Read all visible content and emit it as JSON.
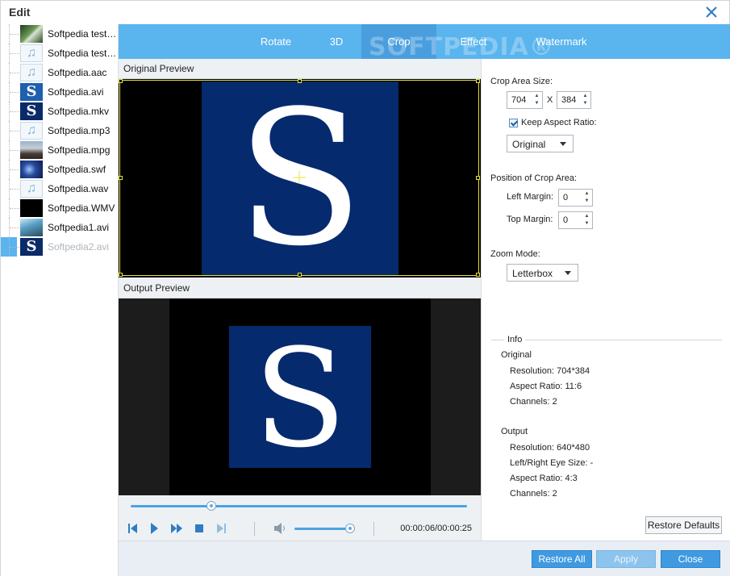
{
  "window": {
    "title": "Edit"
  },
  "files": [
    {
      "name": "Softpedia test ...",
      "thumb": "forest"
    },
    {
      "name": "Softpedia test....",
      "thumb": "audio"
    },
    {
      "name": "Softpedia.aac",
      "thumb": "audio"
    },
    {
      "name": "Softpedia.avi",
      "thumb": "video-s-blue"
    },
    {
      "name": "Softpedia.mkv",
      "thumb": "video-s"
    },
    {
      "name": "Softpedia.mp3",
      "thumb": "audio"
    },
    {
      "name": "Softpedia.mpg",
      "thumb": "crowd"
    },
    {
      "name": "Softpedia.swf",
      "thumb": "lights"
    },
    {
      "name": "Softpedia.wav",
      "thumb": "audio"
    },
    {
      "name": "Softpedia.WMV",
      "thumb": "black"
    },
    {
      "name": "Softpedia1.avi",
      "thumb": "nature"
    },
    {
      "name": "Softpedia2.avi",
      "thumb": "video-s"
    }
  ],
  "tabs": {
    "rotate": "Rotate",
    "three_d": "3D",
    "crop": "Crop",
    "effect": "Effect",
    "watermark": "Watermark"
  },
  "watermark_text": "SOFTPEDIA®",
  "preview": {
    "original_label": "Original Preview",
    "output_label": "Output Preview",
    "logo_letter": "S",
    "progress_fraction": 0.24,
    "volume_fraction": 0.99,
    "timecode": "00:00:06/00:00:25"
  },
  "crop": {
    "area_size_label": "Crop Area Size:",
    "width": "704",
    "x_sep": "X",
    "height": "384",
    "keep_aspect_label": "Keep Aspect Ratio:",
    "keep_aspect_checked": true,
    "aspect_select": "Original",
    "position_label": "Position of Crop Area:",
    "left_margin_label": "Left Margin:",
    "left_margin": "0",
    "top_margin_label": "Top Margin:",
    "top_margin": "0",
    "zoom_mode_label": "Zoom Mode:",
    "zoom_mode": "Letterbox"
  },
  "info": {
    "title": "Info",
    "original_title": "Original",
    "original_resolution": "Resolution: 704*384",
    "original_aspect": "Aspect Ratio: 11:6",
    "original_channels": "Channels: 2",
    "output_title": "Output",
    "output_resolution": "Resolution: 640*480",
    "output_eye_size": "Left/Right Eye Size: -",
    "output_aspect": "Aspect Ratio: 4:3",
    "output_channels": "Channels: 2"
  },
  "buttons": {
    "restore_defaults": "Restore Defaults",
    "restore_all": "Restore All",
    "apply": "Apply",
    "close": "Close"
  },
  "colors": {
    "accent": "#5ab4ee",
    "crop_frame": "#e8e33a",
    "logo_bg": "#062a6e"
  }
}
